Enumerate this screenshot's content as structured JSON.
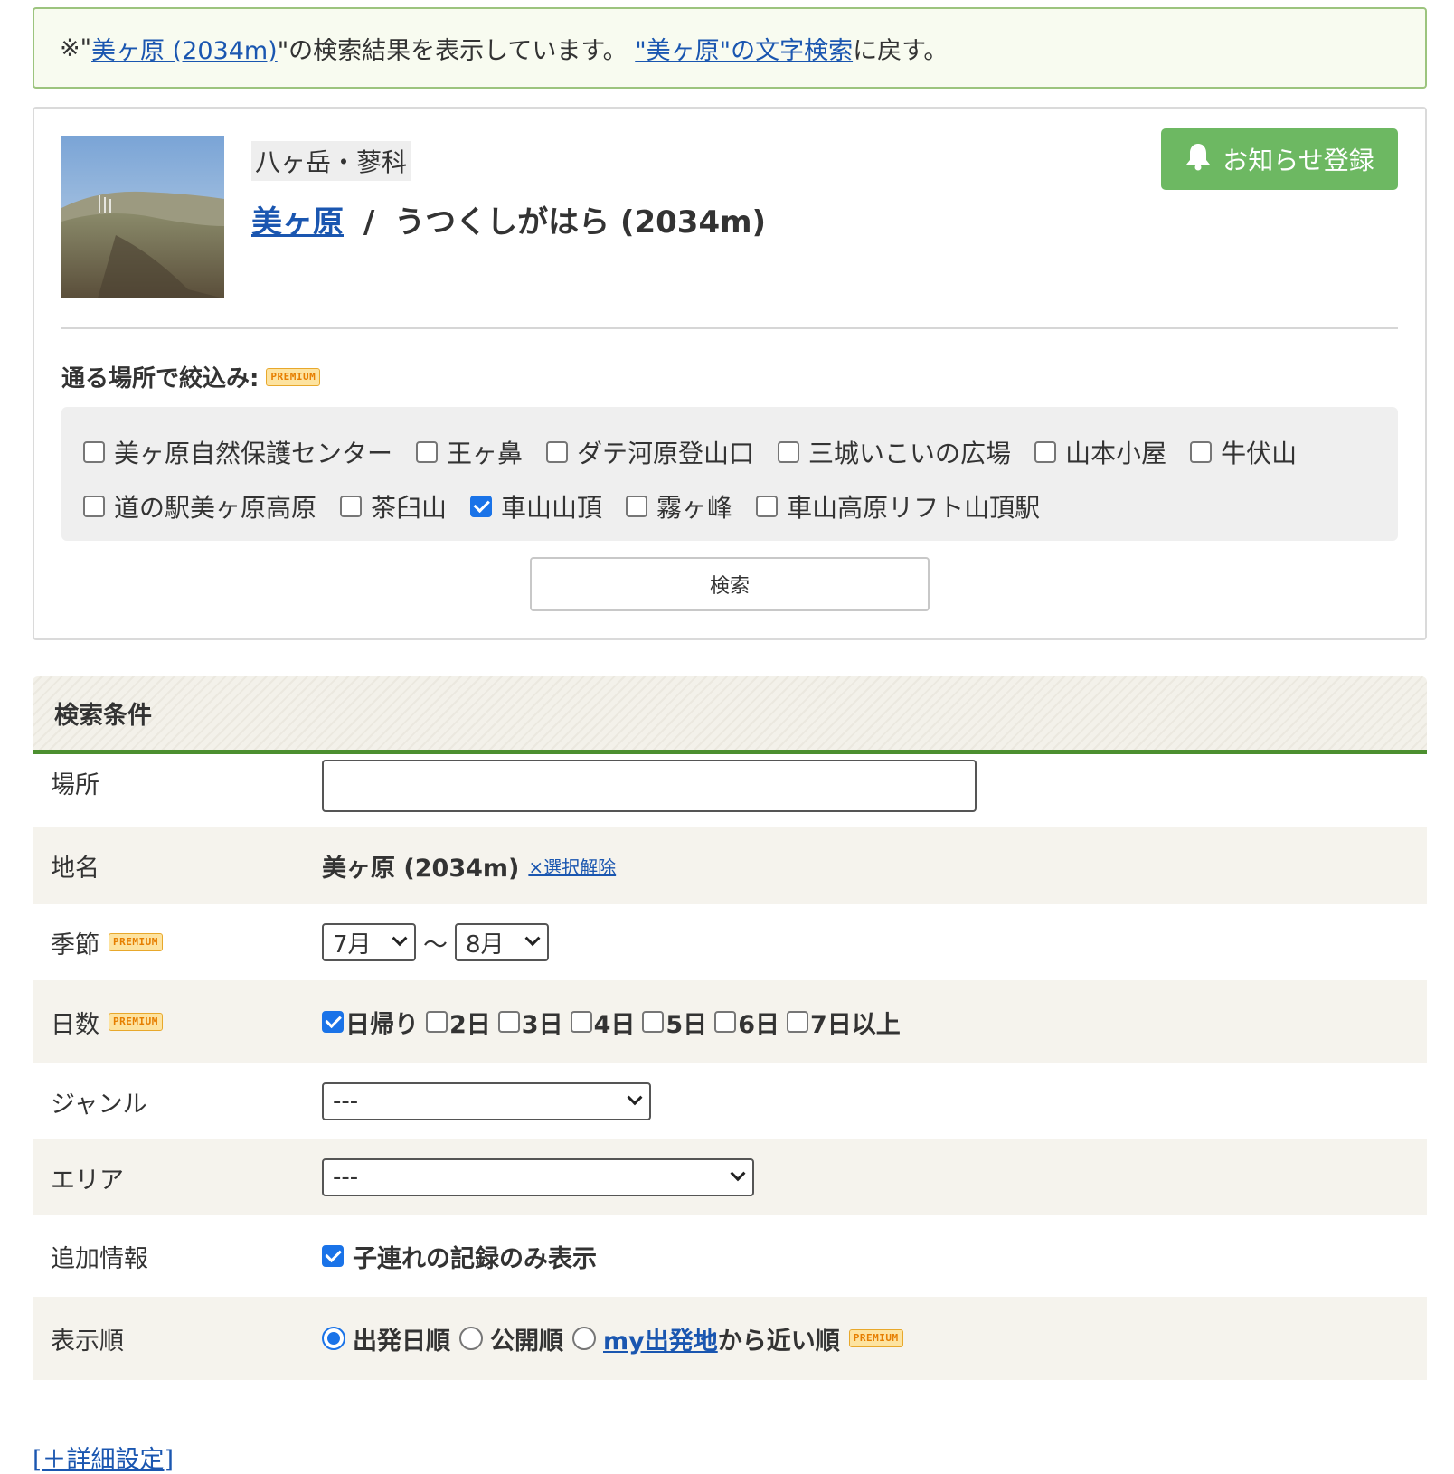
{
  "notice": {
    "prefix": "※\"",
    "link1": "美ヶ原 (2034m)",
    "middle": "\"の検索結果を表示しています。 ",
    "link2": "\"美ヶ原\"の文字検索",
    "suffix": "に戻す。"
  },
  "mountain": {
    "area": "八ヶ岳・蓼科",
    "name_link": "美ヶ原",
    "separator": "/",
    "reading": "うつくしがはら (2034m)",
    "notify_button": "お知らせ登録"
  },
  "filter": {
    "label": "通る場所で絞込み:",
    "premium_badge": "PREMIUM",
    "places_row1": [
      {
        "label": "美ヶ原自然保護センター",
        "checked": false
      },
      {
        "label": "王ヶ鼻",
        "checked": false
      },
      {
        "label": "ダテ河原登山口",
        "checked": false
      },
      {
        "label": "三城いこいの広場",
        "checked": false
      },
      {
        "label": "山本小屋",
        "checked": false
      },
      {
        "label": "牛伏山",
        "checked": false
      }
    ],
    "places_row2": [
      {
        "label": "道の駅美ヶ原高原",
        "checked": false
      },
      {
        "label": "茶臼山",
        "checked": false
      },
      {
        "label": "車山山頂",
        "checked": true
      },
      {
        "label": "霧ヶ峰",
        "checked": false
      },
      {
        "label": "車山高原リフト山頂駅",
        "checked": false
      }
    ],
    "search_button": "検索"
  },
  "conditions": {
    "header": "検索条件",
    "place_label": "場所",
    "place_value": "",
    "placename_label": "地名",
    "placename_value": "美ヶ原 (2034m)",
    "clear_link": "×選択解除",
    "season_label": "季節",
    "season_from": "7月",
    "season_sep": "〜",
    "season_to": "8月",
    "days_label": "日数",
    "days": [
      {
        "label": "日帰り",
        "checked": true
      },
      {
        "label": "2日",
        "checked": false
      },
      {
        "label": "3日",
        "checked": false
      },
      {
        "label": "4日",
        "checked": false
      },
      {
        "label": "5日",
        "checked": false
      },
      {
        "label": "6日",
        "checked": false
      },
      {
        "label": "7日以上",
        "checked": false
      }
    ],
    "genre_label": "ジャンル",
    "genre_value": "---",
    "area_label": "エリア",
    "area_value": "---",
    "extra_label": "追加情報",
    "extra_option": "子連れの記録のみ表示",
    "extra_checked": true,
    "order_label": "表示順",
    "order_opt1": "出発日順",
    "order_opt2": "公開順",
    "order_opt3_link": "my出発地",
    "order_opt3_suffix": "から近い順",
    "order_selected": "出発日順"
  },
  "detail_link": "[＋詳細設定]",
  "colors": {
    "accent_green": "#6db862",
    "header_border": "#4c8f2f",
    "link_blue": "#1a56b0",
    "checkbox_blue": "#1a73e8"
  }
}
